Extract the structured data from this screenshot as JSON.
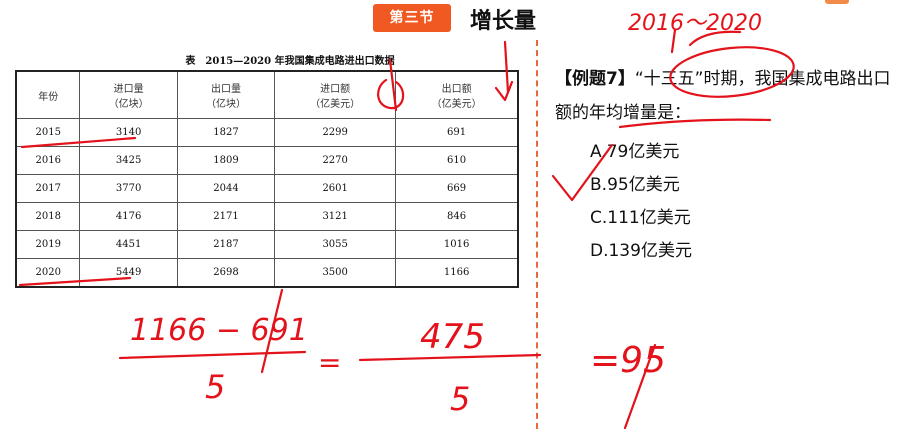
{
  "header": {
    "section_badge": "第三节",
    "section_title": "增长量"
  },
  "table": {
    "caption": "表　2015—2020 年我国集成电路进出口数据",
    "columns": [
      {
        "label": "年份",
        "unit": ""
      },
      {
        "label": "进口量",
        "unit": "（亿块）"
      },
      {
        "label": "出口量",
        "unit": "（亿块）"
      },
      {
        "label": "进口额",
        "unit": "（亿美元）"
      },
      {
        "label": "出口额",
        "unit": "（亿美元）"
      }
    ],
    "rows": [
      [
        "2015",
        "3140",
        "1827",
        "2299",
        "691"
      ],
      [
        "2016",
        "3425",
        "1809",
        "2270",
        "610"
      ],
      [
        "2017",
        "3770",
        "2044",
        "2601",
        "669"
      ],
      [
        "2018",
        "4176",
        "2171",
        "3121",
        "846"
      ],
      [
        "2019",
        "4451",
        "2187",
        "3055",
        "1016"
      ],
      [
        "2020",
        "5449",
        "2698",
        "3500",
        "1166"
      ]
    ]
  },
  "question": {
    "tag": "【例题7】",
    "text": "“十三五”时期，我国集成电路出口额的年均增量是：",
    "options": [
      "A.79亿美元",
      "B.95亿美元",
      "C.111亿美元",
      "D.139亿美元"
    ]
  },
  "annotations": {
    "years": "2016～2020",
    "calc_left_numerator": "1166 − 691",
    "calc_left_denominator": "5",
    "calc_mid_numerator": "475",
    "calc_mid_denominator": "5",
    "calc_equals": "=",
    "calc_result": "=95",
    "ink_color": "#e3121b"
  }
}
